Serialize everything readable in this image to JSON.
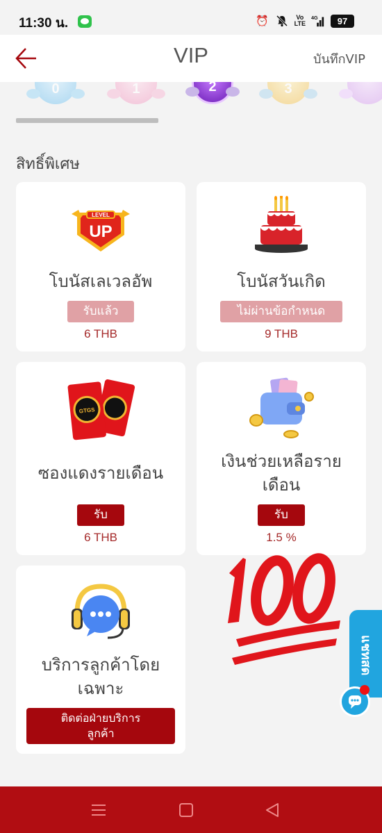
{
  "status_bar": {
    "time": "11:30 น.",
    "volte": "Vo\nLTE",
    "network": "4G",
    "battery": "97"
  },
  "header": {
    "title": "VIP",
    "right_link": "บันทึกVIP"
  },
  "vip_levels": [
    "0",
    "1",
    "2",
    "3"
  ],
  "section_title": "สิทธิ์พิเศษ",
  "cards": {
    "levelup": {
      "logo_text": "UP",
      "logo_small": "LEVEL",
      "title": "โบนัสเลเวลอัพ",
      "status": "รับแล้ว",
      "value": "6 THB"
    },
    "birthday": {
      "title": "โบนัสวันเกิด",
      "status": "ไม่ผ่านข้อกำหนด",
      "value": "9 THB"
    },
    "redenvelope": {
      "logo_text": "GTGS",
      "title": "ซองแดงรายเดือน",
      "status": "รับ",
      "value": "6 THB"
    },
    "assistance": {
      "title_line1": "เงินช่วยเหลือราย",
      "title_line2": "เดือน",
      "status": "รับ",
      "value": "1.5 %"
    },
    "service": {
      "title_line1": "บริการลูกค้าโดย",
      "title_line2": "เฉพาะ",
      "button": "ติดต่อฝ่ายบริการลูกค้า"
    }
  },
  "side_tab": {
    "label": "แชทสด"
  },
  "colors": {
    "brand_red": "#a5070d",
    "nav_red": "#b10d12",
    "side_blue": "#21a5df"
  }
}
